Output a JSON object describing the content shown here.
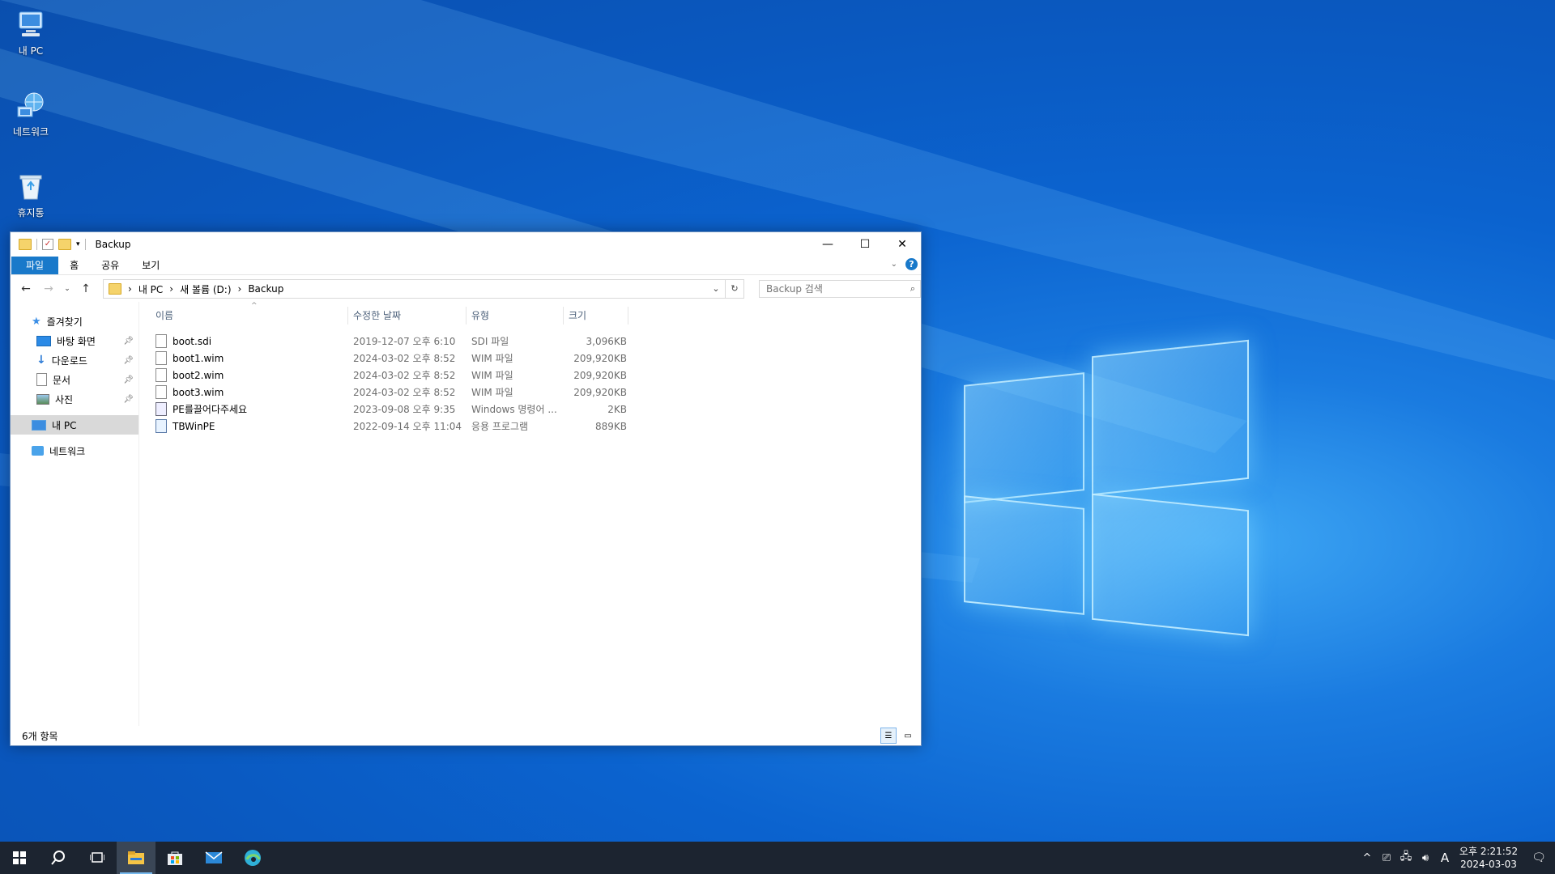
{
  "desktop": {
    "icons": [
      {
        "label": "내 PC",
        "icon": "this-pc-icon"
      },
      {
        "label": "네트워크",
        "icon": "network-icon"
      },
      {
        "label": "휴지통",
        "icon": "recycle-bin-icon"
      }
    ]
  },
  "window": {
    "title": "Backup",
    "controls": {
      "minimize": "—",
      "maximize": "☐",
      "close": "✕"
    }
  },
  "ribbon": {
    "tabs": [
      "파일",
      "홈",
      "공유",
      "보기"
    ],
    "help": "?"
  },
  "address": {
    "crumbs": [
      "내 PC",
      "새 볼륨 (D:)",
      "Backup"
    ]
  },
  "search": {
    "placeholder": "Backup 검색"
  },
  "sidebar": {
    "quick_access": "즐겨찾기",
    "items": [
      {
        "label": "바탕 화면",
        "icon": "desktop-icon"
      },
      {
        "label": "다운로드",
        "icon": "download-icon"
      },
      {
        "label": "문서",
        "icon": "documents-icon"
      },
      {
        "label": "사진",
        "icon": "pictures-icon"
      }
    ],
    "this_pc": "내 PC",
    "network": "네트워크"
  },
  "columns": {
    "name": "이름",
    "date": "수정한 날짜",
    "type": "유형",
    "size": "크기"
  },
  "files": [
    {
      "name": "boot.sdi",
      "date": "2019-12-07 오후 6:10",
      "type": "SDI 파일",
      "size": "3,096KB",
      "icon": "file-icon"
    },
    {
      "name": "boot1.wim",
      "date": "2024-03-02 오후 8:52",
      "type": "WIM 파일",
      "size": "209,920KB",
      "icon": "file-icon"
    },
    {
      "name": "boot2.wim",
      "date": "2024-03-02 오후 8:52",
      "type": "WIM 파일",
      "size": "209,920KB",
      "icon": "file-icon"
    },
    {
      "name": "boot3.wim",
      "date": "2024-03-02 오후 8:52",
      "type": "WIM 파일",
      "size": "209,920KB",
      "icon": "file-icon"
    },
    {
      "name": "PE를끌어다주세요",
      "date": "2023-09-08 오후 9:35",
      "type": "Windows 명령어 ...",
      "size": "2KB",
      "icon": "command-file-icon"
    },
    {
      "name": "TBWinPE",
      "date": "2022-09-14 오후 11:04",
      "type": "응용 프로그램",
      "size": "889KB",
      "icon": "application-icon"
    }
  ],
  "status": {
    "count": "6개 항목"
  },
  "taskbar": {
    "clock_time": "오후 2:21:52",
    "clock_date": "2024-03-03",
    "ime": "A"
  },
  "colors": {
    "accent": "#1979ca",
    "taskbar": "#1c2430",
    "desktop": "#0b63cf"
  }
}
